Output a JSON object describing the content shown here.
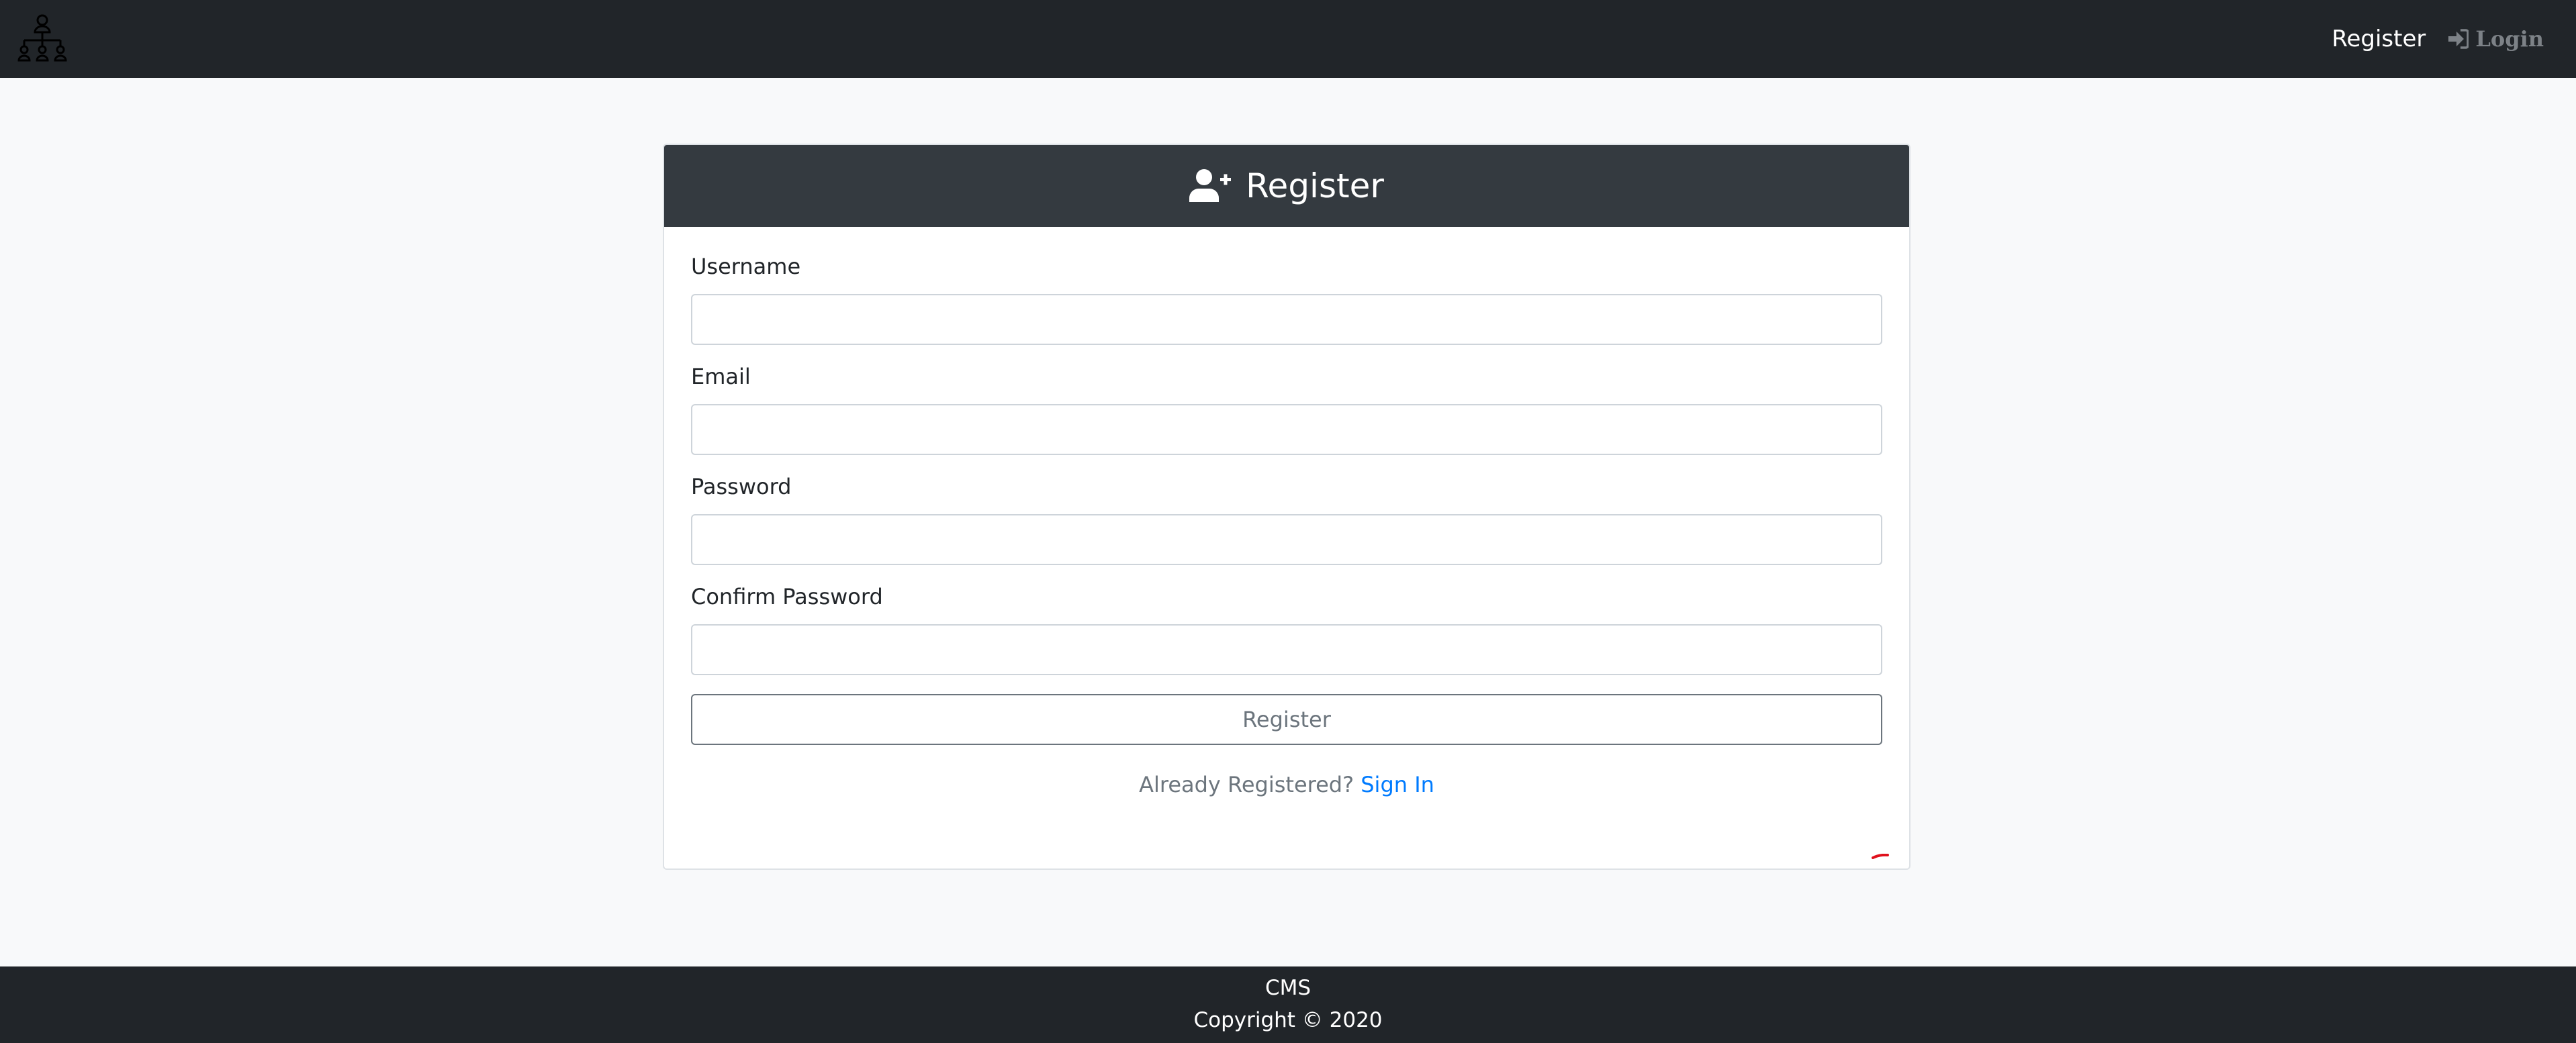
{
  "navbar": {
    "logo_icon": "hierarchy-icon",
    "register_label": "Register",
    "login_label": "Login",
    "login_icon": "sign-in-icon",
    "colors": {
      "bg": "#212529",
      "active": "#ffffff",
      "muted": "#7d8287"
    }
  },
  "card": {
    "header_icon": "user-plus-icon",
    "title": "Register",
    "fields": {
      "username": {
        "label": "Username",
        "value": ""
      },
      "email": {
        "label": "Email",
        "value": ""
      },
      "password": {
        "label": "Password",
        "value": ""
      },
      "confirm_password": {
        "label": "Confirm Password",
        "value": ""
      }
    },
    "submit_label": "Register",
    "already_registered": "Already Registered?",
    "signin_label": "Sign In",
    "colors": {
      "header_bg": "#343a40",
      "link": "#007bff"
    }
  },
  "footer": {
    "brand": "CMS",
    "copyright": "Copyright © 2020"
  }
}
